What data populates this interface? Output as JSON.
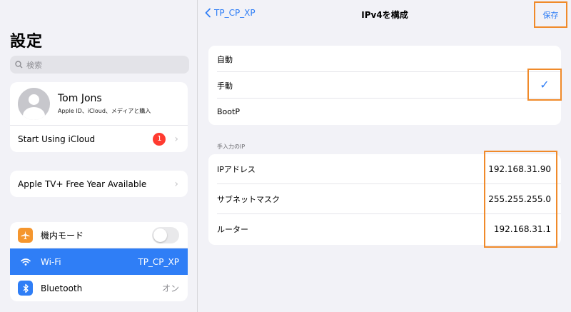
{
  "sidebar": {
    "title": "設定",
    "search_placeholder": "検索",
    "profile": {
      "name": "Tom Jons",
      "subtitle": "Apple ID、iCloud、メディアと購入"
    },
    "icloud": {
      "label": "Start Using iCloud",
      "badge": "1"
    },
    "appletv": {
      "label": "Apple TV+ Free Year Available"
    },
    "settings": [
      {
        "label": "機内モード",
        "icon": "airplane-icon",
        "icon_color": "#f5962e",
        "toggle": false
      },
      {
        "label": "Wi-Fi",
        "icon": "wifi-icon",
        "icon_color": "#2f7ef6",
        "value": "TP_CP_XP",
        "selected": true
      },
      {
        "label": "Bluetooth",
        "icon": "bluetooth-icon",
        "icon_color": "#2f7ef6",
        "value": "オン"
      }
    ]
  },
  "navbar": {
    "back_label": "TP_CP_XP",
    "title": "IPv4を構成",
    "save_label": "保存"
  },
  "methods": [
    {
      "label": "自動"
    },
    {
      "label": "手動",
      "checked": true
    },
    {
      "label": "BootP"
    }
  ],
  "manual_section": {
    "header": "手入力のIP",
    "rows": [
      {
        "label": "IPアドレス",
        "value": "192.168.31.90"
      },
      {
        "label": "サブネットマスク",
        "value": "255.255.255.0"
      },
      {
        "label": "ルーター",
        "value": "192.168.31.1"
      }
    ]
  },
  "colors": {
    "accent": "#2f7ef6",
    "highlight": "#f08a2a",
    "badge": "#ff3b30"
  }
}
